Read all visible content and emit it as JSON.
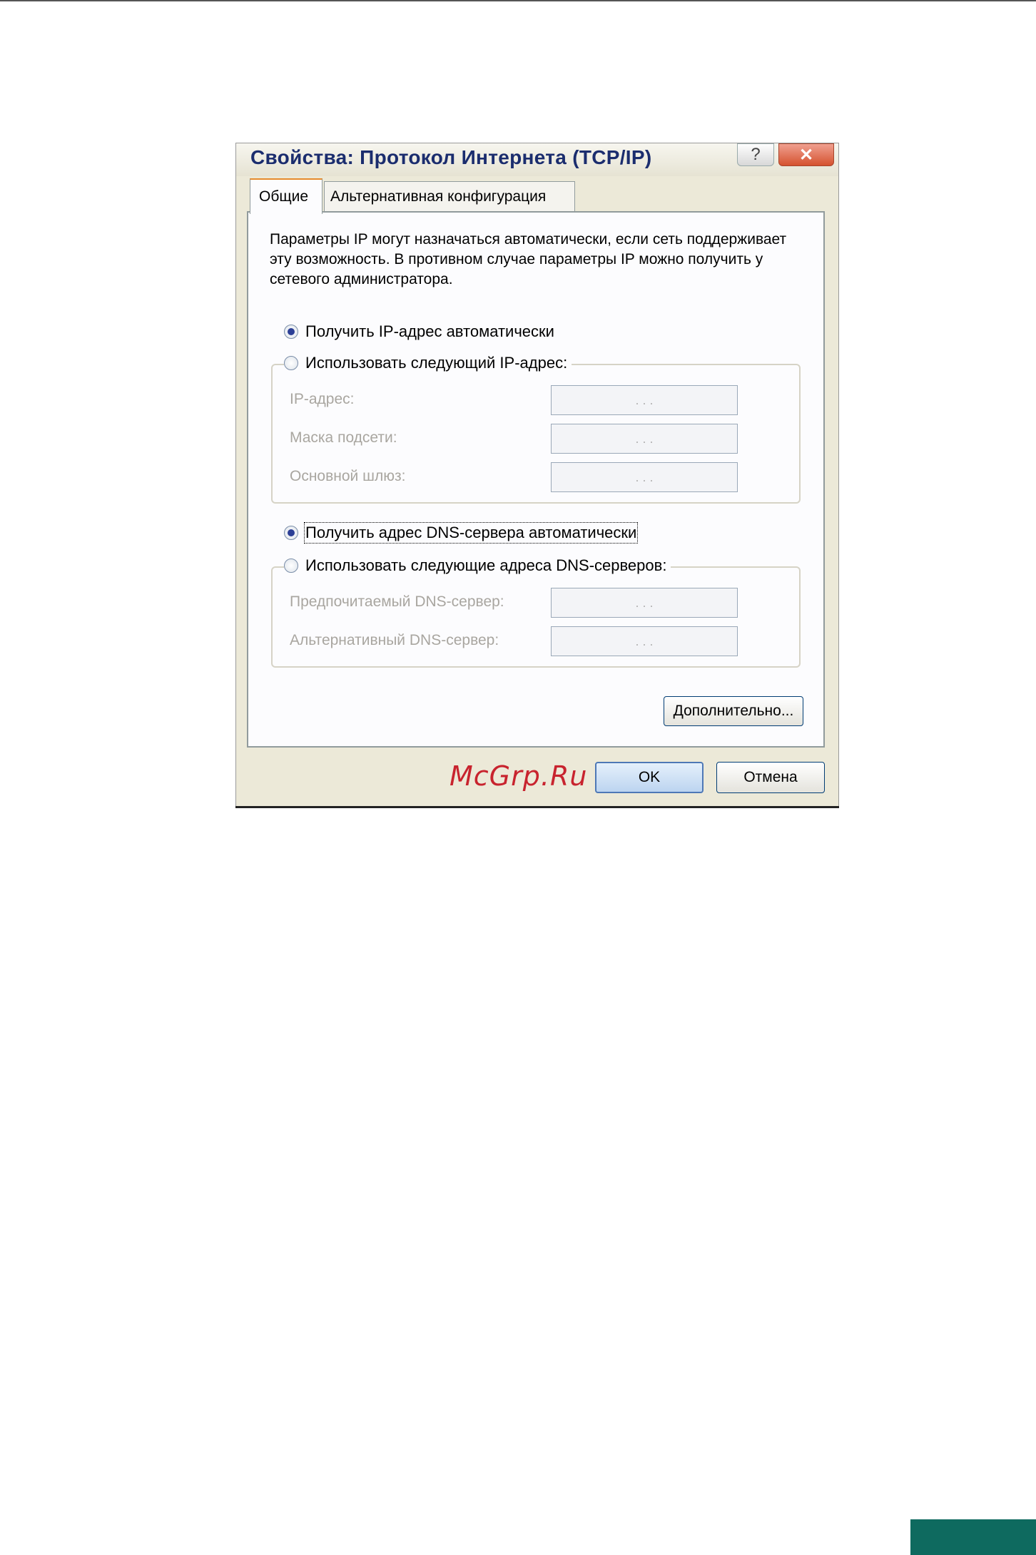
{
  "dialog": {
    "title": "Свойства: Протокол Интернета (TCP/IP)",
    "help_button": "?",
    "close_button": "✕"
  },
  "tabs": [
    {
      "label": "Общие",
      "active": true
    },
    {
      "label": "Альтернативная конфигурация",
      "active": false
    }
  ],
  "general": {
    "intro_text": "Параметры IP могут назначаться автоматически, если сеть поддерживает эту возможность. В противном случае параметры IP можно получить у сетевого администратора.",
    "ip_auto_label": "Получить IP-адрес автоматически",
    "ip_auto_selected": true,
    "ip_manual_label": "Использовать следующий IP-адрес:",
    "ip_address_label": "IP-адрес:",
    "subnet_mask_label": "Маска подсети:",
    "gateway_label": "Основной шлюз:",
    "dns_auto_label": "Получить адрес DNS-сервера автоматически",
    "dns_auto_selected": true,
    "dns_manual_label": "Использовать следующие адреса DNS-серверов:",
    "preferred_dns_label": "Предпочитаемый DNS-сервер:",
    "alternate_dns_label": "Альтернативный DNS-сервер:",
    "ip_placeholder_dots": ". . ."
  },
  "buttons": {
    "advanced": "Дополнительно...",
    "ok": "OK",
    "cancel": "Отмена"
  },
  "watermark": "McGrp.Ru",
  "colors": {
    "title": "#1b2d6e",
    "selected_radio": "#2c3f96",
    "watermark": "#c8232e",
    "corner_block": "#0e6a5f"
  }
}
